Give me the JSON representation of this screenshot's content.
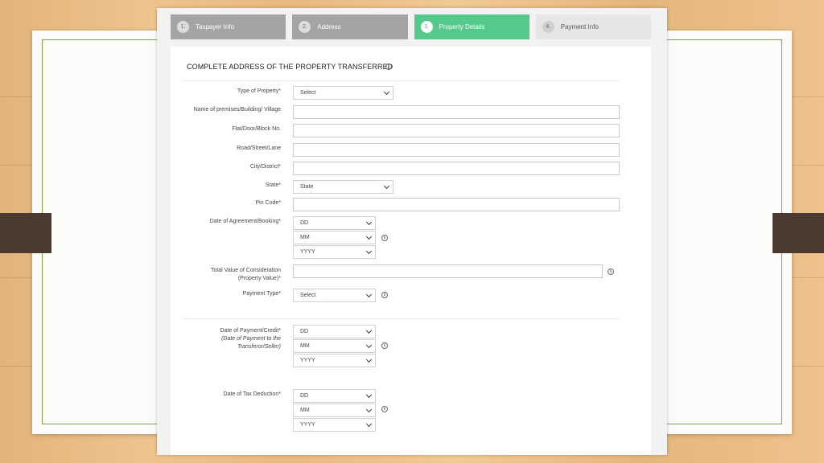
{
  "steps": [
    {
      "number": "1.",
      "label": "Taxpayer Info"
    },
    {
      "number": "2.",
      "label": "Address"
    },
    {
      "number": "3.",
      "label": "Property Details"
    },
    {
      "number": "4.",
      "label": "Payment Info"
    }
  ],
  "section": {
    "title": "COMPLETE ADDRESS OF THE PROPERTY TRANSFERRED",
    "info_icon": "info-icon"
  },
  "form": {
    "property_type": {
      "label": "Type of Property*",
      "value": "Select"
    },
    "premises": {
      "label": "Name of premises/Building/ Village",
      "value": ""
    },
    "flat": {
      "label": "Flat/Door/Block No.",
      "value": ""
    },
    "road": {
      "label": "Road/Street/Lane",
      "value": ""
    },
    "city": {
      "label": "City/District*",
      "value": ""
    },
    "state": {
      "label": "State*",
      "value": "State"
    },
    "pin": {
      "label": "Pin Code*",
      "value": ""
    },
    "agreement_date": {
      "label": "Date of Agreement/Booking*",
      "dd": "DD",
      "mm": "MM",
      "yyyy": "YYYY"
    },
    "consideration": {
      "label_line1": "Total Value of Consideration",
      "label_line2": "(Property Value)*",
      "value": ""
    },
    "payment_type": {
      "label": "Payment Type*",
      "value": "Select"
    },
    "payment_date": {
      "label": "Date of Payment/Credit*",
      "note_line1": "(Date of Payment to the",
      "note_line2": "Transferor/Seller)",
      "dd": "DD",
      "mm": "MM",
      "yyyy": "YYYY"
    },
    "deduction_date": {
      "label": "Date of Tax Deduction*",
      "dd": "DD",
      "mm": "MM",
      "yyyy": "YYYY"
    }
  },
  "colors": {
    "active_step": "#54c98b",
    "inactive_step": "#a4a4a4",
    "pending_step": "#e6e6e6",
    "card_border": "#7da24a",
    "strap": "#4a3a30"
  }
}
